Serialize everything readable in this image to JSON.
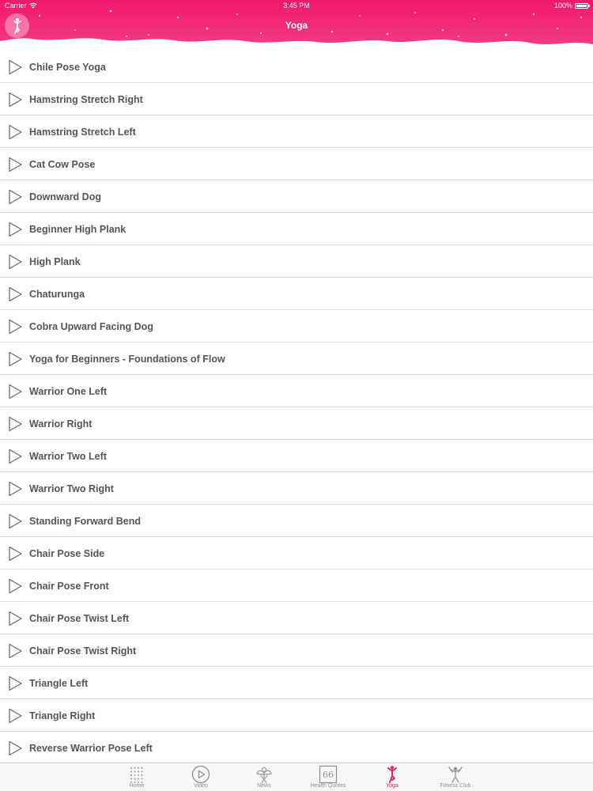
{
  "status_bar": {
    "carrier": "Carrier",
    "time": "3:45 PM",
    "battery": "100%"
  },
  "header": {
    "title": "Yoga",
    "avatar_icon": "yoga-person-icon",
    "accent_color": "#f0186e"
  },
  "list": {
    "row_icon": "play-triangle-icon",
    "items": [
      "Chile Pose Yoga",
      "Hamstring Stretch Right",
      "Hamstring Stretch Left",
      "Cat Cow Pose",
      "Downward Dog",
      "Beginner High Plank",
      "High Plank",
      "Chaturunga",
      "Cobra Upward Facing Dog",
      "Yoga for Beginners - Foundations of Flow",
      "Warrior One Left",
      "Warrior Right",
      "Warrior Two Left",
      "Warrior Two Right",
      "Standing Forward Bend",
      "Chair Pose Side",
      "Chair Pose Front",
      "Chair Pose Twist Left",
      "Chair Pose Twist Right",
      "Triangle Left",
      "Triangle Right",
      "Reverse Warrior Pose Left"
    ]
  },
  "tabbar": {
    "active_color": "#e6246b",
    "tabs": [
      {
        "label": "Home",
        "icon": "dots-grid-icon",
        "active": false
      },
      {
        "label": "Video",
        "icon": "play-circle-icon",
        "active": false
      },
      {
        "label": "News",
        "icon": "angel-icon",
        "active": false
      },
      {
        "label": "Health Quotes",
        "icon": "quote-icon",
        "active": false
      },
      {
        "label": "Yoga",
        "icon": "yoga-person-icon",
        "active": true
      },
      {
        "label": "Fitness Club",
        "icon": "fitness-person-icon",
        "active": false
      }
    ]
  }
}
